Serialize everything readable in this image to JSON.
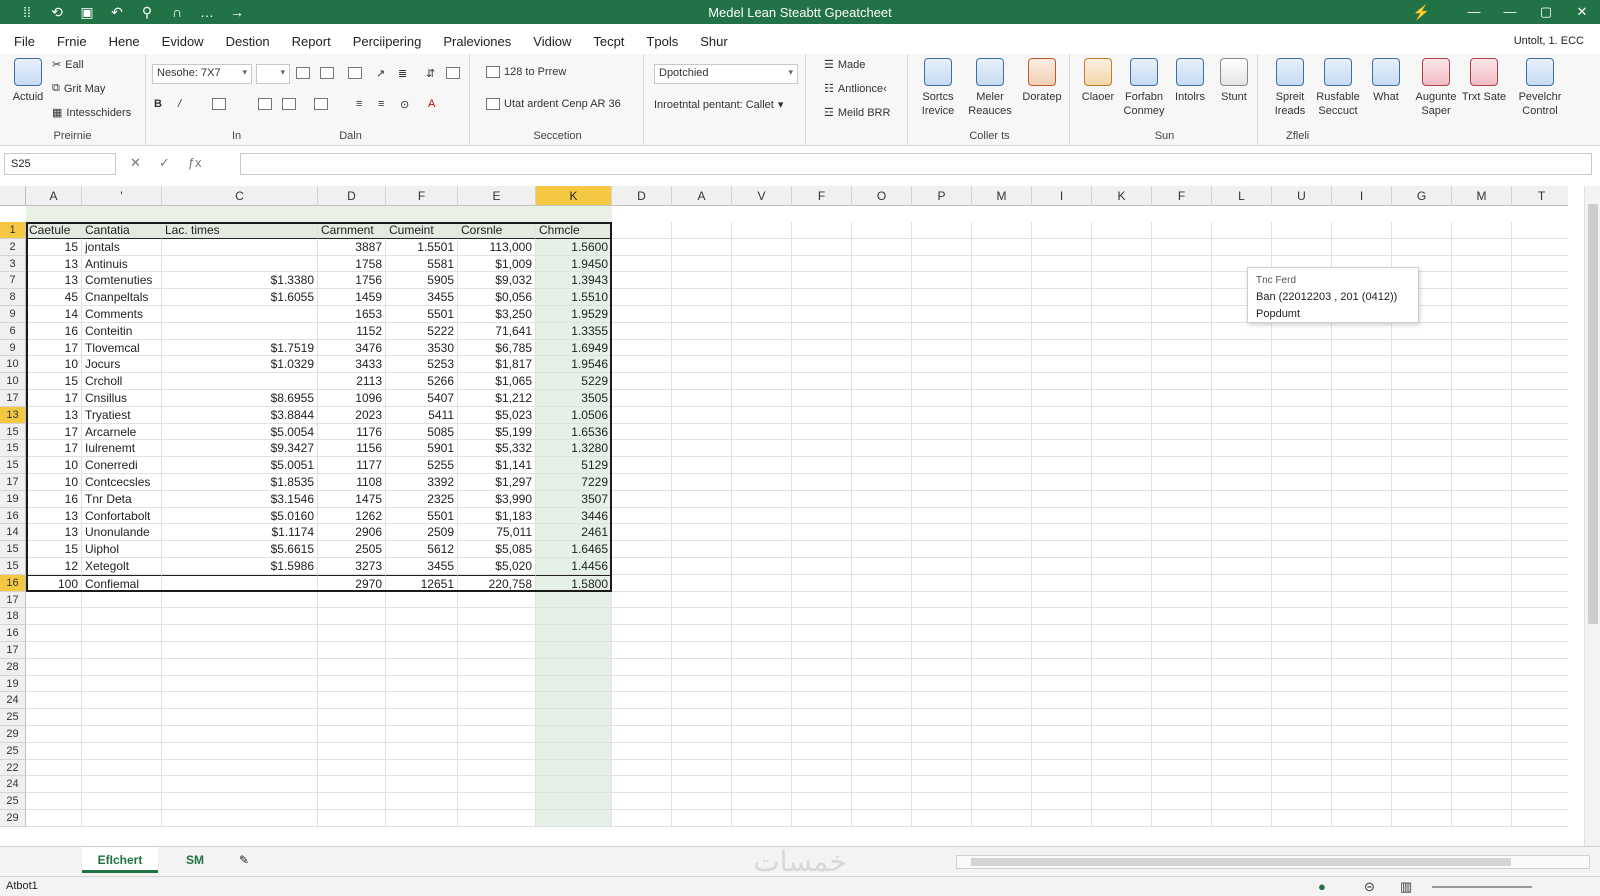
{
  "window": {
    "title": "Medel Lean Steabtt Gpeatcheet",
    "qa_icons": [
      "grip-icon",
      "autosave-icon",
      "save-icon",
      "undo-icon",
      "search-icon",
      "touch-icon"
    ],
    "qa_glyphs": [
      "⁞⁞",
      "⟲",
      "▣",
      "↶",
      "⚲",
      "∩"
    ],
    "min_glyph": "—",
    "max_glyph": "▢",
    "close_glyph": "✕",
    "pin_glyph": "⚡",
    "more_glyph": "…",
    "arrow_glyph": "→"
  },
  "menu": {
    "items": [
      "File",
      "Frnie",
      "Hene",
      "Evidow",
      "Destion",
      "Report",
      "Perciipering",
      "Praleviones",
      "Vidiow",
      "Tecpt",
      "Tpols",
      "Shur"
    ],
    "account": "Untolt, 1. ECC"
  },
  "ribbon": {
    "clipboard": {
      "paste": "Actuid",
      "cut": "Eall",
      "copy": "Grit May",
      "format": "Intesschiders",
      "label": "Preirnie"
    },
    "font": {
      "name": "Nesohe: 7X7",
      "label": "In"
    },
    "align": {
      "label": "Daln"
    },
    "number": {
      "wrap": "128 to Prrew",
      "merge": "Utat ardent Cenp AR 36",
      "label": "Seccetion"
    },
    "styles": {
      "format": "Dpotchied",
      "cond": "Inroetntal pentant: Callet",
      "label": ""
    },
    "cells": {
      "insert": "Made",
      "delete": "Antlionce‹",
      "format": "Meild BRR",
      "label": ""
    },
    "editing": {
      "label": "Coller ts",
      "buttons": [
        {
          "label": "Sortcs Irevice",
          "icon": "globe-icon"
        },
        {
          "label": "Meler Reauces",
          "icon": "find-icon"
        },
        {
          "label": "Doratep",
          "icon": "data-icon"
        }
      ]
    },
    "analysis": {
      "label": "Sun",
      "buttons": [
        {
          "label": "Claoer",
          "icon": "person-icon"
        },
        {
          "label": "Forfabn Conmey",
          "icon": "document-icon"
        },
        {
          "label": "Intolrs",
          "icon": "chart-icon"
        },
        {
          "label": "Stunt",
          "icon": "list-icon"
        }
      ]
    },
    "share": {
      "label": "Zfleli",
      "buttons": [
        {
          "label": "Spreit Ireads",
          "icon": "screen-icon"
        },
        {
          "label": "Rusfable Seccuct",
          "icon": "network-icon"
        },
        {
          "label": "What",
          "icon": "form-icon"
        },
        {
          "label": "Augunte Saper",
          "icon": "image-icon"
        },
        {
          "label": "Trxt Sate",
          "icon": "cloud-icon"
        },
        {
          "label": "Pevelchr Control",
          "icon": "grid-icon"
        }
      ]
    }
  },
  "formula_bar": {
    "name_box": "S25",
    "formula": ""
  },
  "grid": {
    "columns": [
      "A",
      "'",
      "C",
      "D",
      "F",
      "E",
      "K",
      "D",
      "A",
      "V",
      "F",
      "O",
      "P",
      "M",
      "I",
      "K",
      "F",
      "L",
      "U",
      "I",
      "G",
      "M",
      "T",
      "K"
    ],
    "selected_column": "K",
    "headers": [
      "Caetule",
      "Cantatia",
      "Lac. times",
      "Carnment",
      "Cumeint",
      "Corsnle",
      "Chmcle"
    ],
    "rows": [
      {
        "num": "2",
        "cells": [
          "15",
          "jontals",
          "",
          "3887",
          "1.5501",
          "113,000",
          "1.5600"
        ]
      },
      {
        "num": "3",
        "cells": [
          "13",
          "Antinuis",
          "",
          "1758",
          "5581",
          "$1,009",
          "1.9450"
        ]
      },
      {
        "num": "7",
        "cells": [
          "13",
          "Comtenuties",
          "$1.3380",
          "1756",
          "5905",
          "$9,032",
          "1.3943"
        ]
      },
      {
        "num": "8",
        "cells": [
          "45",
          "Cnanpeltals",
          "$1.6055",
          "1459",
          "3455",
          "$0,056",
          "1.5510"
        ]
      },
      {
        "num": "9",
        "cells": [
          "14",
          "Comments",
          "",
          "1653",
          "5501",
          "$3,250",
          "1.9529"
        ]
      },
      {
        "num": "6",
        "cells": [
          "16",
          "Conteitin",
          "",
          "1152",
          "5222",
          "71,641",
          "1.3355"
        ]
      },
      {
        "num": "9",
        "cells": [
          "17",
          "Tlovemcal",
          "$1.7519",
          "3476",
          "3530",
          "$6,785",
          "1.6949"
        ]
      },
      {
        "num": "10",
        "cells": [
          "10",
          "Jocurs",
          "$1.0329",
          "3433",
          "5253",
          "$1,817",
          "1.9546"
        ]
      },
      {
        "num": "10",
        "cells": [
          "15",
          "Crcholl",
          "",
          "2113",
          "5266",
          "$1,065",
          "5229"
        ]
      },
      {
        "num": "17",
        "cells": [
          "17",
          "Cnsillus",
          "$8.6955",
          "1096",
          "5407",
          "$1,212",
          "3505"
        ]
      },
      {
        "num": "13",
        "cells": [
          "13",
          "Tryatiest",
          "$3.8844",
          "2023",
          "5411",
          "$5,023",
          "1.0506"
        ]
      },
      {
        "num": "15",
        "cells": [
          "17",
          "Arcarnele",
          "$5.0054",
          "1176",
          "5085",
          "$5,199",
          "1.6536"
        ]
      },
      {
        "num": "15",
        "cells": [
          "17",
          "Iulrenemt",
          "$9.3427",
          "1156",
          "5901",
          "$5,332",
          "1.3280"
        ]
      },
      {
        "num": "15",
        "cells": [
          "10",
          "Conerredi",
          "$5.0051",
          "1177",
          "5255",
          "$1,141",
          "5129"
        ]
      },
      {
        "num": "17",
        "cells": [
          "10",
          "Contcecsles",
          "$1.8535",
          "1108",
          "3392",
          "$1,297",
          "7229"
        ]
      },
      {
        "num": "19",
        "cells": [
          "16",
          "Tnr Deta",
          "$3.1546",
          "1475",
          "2325",
          "$3,990",
          "3507"
        ]
      },
      {
        "num": "16",
        "cells": [
          "13",
          "Confortabolt",
          "$5.0160",
          "1262",
          "5501",
          "$1,183",
          "3446"
        ]
      },
      {
        "num": "14",
        "cells": [
          "13",
          "Unonulande",
          "$1.1174",
          "2906",
          "2509",
          "75,011",
          "2461"
        ]
      },
      {
        "num": "15",
        "cells": [
          "15",
          "Uiphol",
          "$5.6615",
          "2505",
          "5612",
          "$5,085",
          "1.6465"
        ]
      },
      {
        "num": "15",
        "cells": [
          "12",
          "Xetegolt",
          "$1.5986",
          "3273",
          "3455",
          "$5,020",
          "1.4456"
        ]
      }
    ],
    "total": {
      "num": "16",
      "cells": [
        "100",
        "Confiemal",
        "",
        "2970",
        "12651",
        "220,758",
        "1.5800"
      ]
    },
    "empty_rows": [
      "17",
      "18",
      "16",
      "17",
      "28",
      "19",
      "24",
      "25",
      "29",
      "25",
      "22",
      "24",
      "25",
      "29"
    ]
  },
  "tooltip": {
    "title": "Tnc Ferd",
    "line": "Ban (22012203 , 201 (0412))",
    "footer": "Popdumt"
  },
  "tabs": {
    "sheets": [
      "EfIchert",
      "SM"
    ],
    "add": "✎"
  },
  "status": {
    "text": "Atbot1",
    "watermark": "خمسات"
  }
}
